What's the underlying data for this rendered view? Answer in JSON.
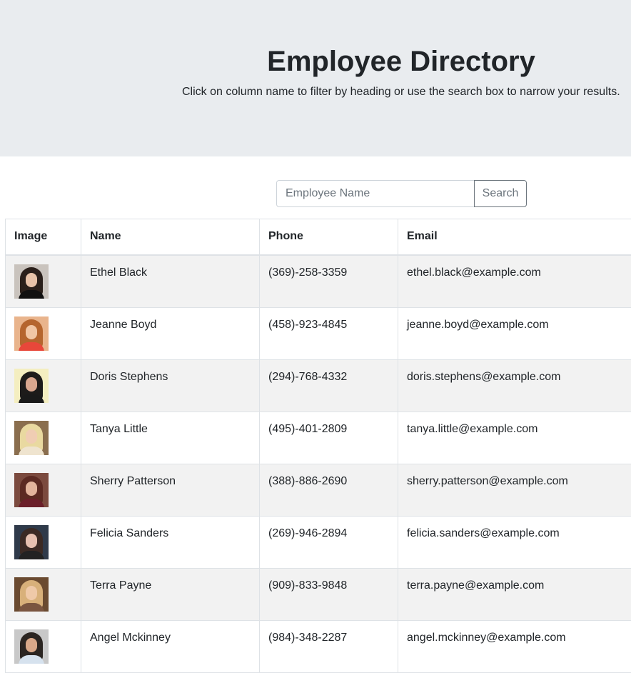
{
  "header": {
    "title": "Employee Directory",
    "subtitle": "Click on column name to filter by heading or use the search box to narrow your results."
  },
  "search": {
    "placeholder": "Employee Name",
    "value": "",
    "button_label": "Search"
  },
  "table": {
    "columns": [
      "Image",
      "Name",
      "Phone",
      "Email"
    ],
    "rows": [
      {
        "name": "Ethel Black",
        "phone": "(369)-258-3359",
        "email": "ethel.black@example.com"
      },
      {
        "name": "Jeanne Boyd",
        "phone": "(458)-923-4845",
        "email": "jeanne.boyd@example.com"
      },
      {
        "name": "Doris Stephens",
        "phone": "(294)-768-4332",
        "email": "doris.stephens@example.com"
      },
      {
        "name": "Tanya Little",
        "phone": "(495)-401-2809",
        "email": "tanya.little@example.com"
      },
      {
        "name": "Sherry Patterson",
        "phone": "(388)-886-2690",
        "email": "sherry.patterson@example.com"
      },
      {
        "name": "Felicia Sanders",
        "phone": "(269)-946-2894",
        "email": "felicia.sanders@example.com"
      },
      {
        "name": "Terra Payne",
        "phone": "(909)-833-9848",
        "email": "terra.payne@example.com"
      },
      {
        "name": "Angel Mckinney",
        "phone": "(984)-348-2287",
        "email": "angel.mckinney@example.com"
      }
    ]
  },
  "colors": {
    "header_background": "#e9ecef",
    "stripe": "#f2f2f2",
    "border": "#dee2e6",
    "button_border": "#6c757d",
    "avatars": [
      {
        "bg": "#c9c3bd",
        "hair": "#2a1f1a",
        "skin": "#e8c2a8",
        "body": "#111111"
      },
      {
        "bg": "#e9b48c",
        "hair": "#b5652e",
        "skin": "#f1c6a4",
        "body": "#e8473a"
      },
      {
        "bg": "#f4eec0",
        "hair": "#1d1b1a",
        "skin": "#d9a78f",
        "body": "#1a1a1a"
      },
      {
        "bg": "#8a6e4e",
        "hair": "#e9d9a0",
        "skin": "#f0cdb3",
        "body": "#efe4cf"
      },
      {
        "bg": "#7b4a3e",
        "hair": "#5c2a22",
        "skin": "#e3b49c",
        "body": "#6b1f2a"
      },
      {
        "bg": "#2f3a4a",
        "hair": "#3b2a24",
        "skin": "#e6c0b0",
        "body": "#222222"
      },
      {
        "bg": "#6a4a30",
        "hair": "#d8b07a",
        "skin": "#efc9a8",
        "body": "#7a5540"
      },
      {
        "bg": "#c8c8c8",
        "hair": "#2b2521",
        "skin": "#d9a889",
        "body": "#d6e2ee"
      }
    ]
  }
}
